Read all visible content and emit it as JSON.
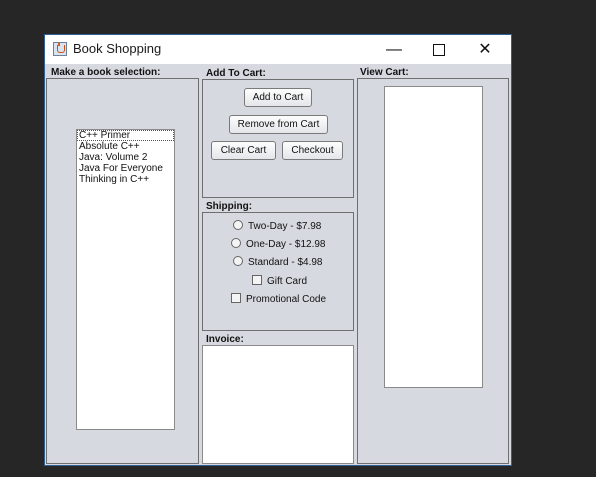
{
  "window": {
    "title": "Book Shopping",
    "minimize_glyph": "—",
    "close_glyph": "✕"
  },
  "selection": {
    "label": "Make a book selection:",
    "books": [
      "C++ Primer",
      "Absolute C++",
      "Java: Volume 2",
      "Java For Everyone",
      "Thinking in C++"
    ],
    "selected": "C++ Primer"
  },
  "add_to_cart": {
    "label": "Add To Cart:",
    "add_button": "Add to Cart",
    "remove_button": "Remove from Cart",
    "clear_button": "Clear Cart",
    "checkout_button": "Checkout"
  },
  "shipping": {
    "label": "Shipping:",
    "options": [
      "Two-Day - $7.98",
      "One-Day - $12.98",
      "Standard - $4.98"
    ],
    "gift_card": "Gift Card",
    "promo_code": "Promotional Code"
  },
  "invoice": {
    "label": "Invoice:"
  },
  "cart": {
    "label": "View Cart:"
  },
  "icons": {
    "app": "java-cup-icon"
  }
}
